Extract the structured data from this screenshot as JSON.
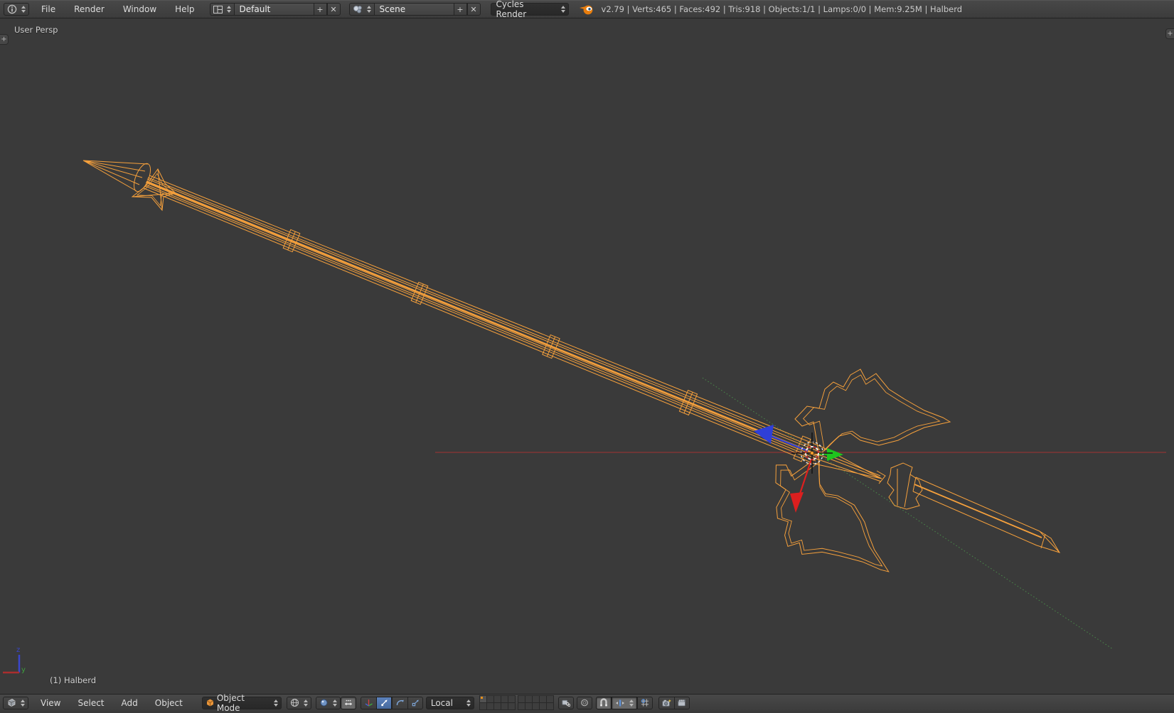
{
  "colors": {
    "wireframe": "#f5a03c",
    "grid_x_axis": "#8e3434",
    "grid_y_axis": "#4a8a4a",
    "manip_x": "#dc1f1f",
    "manip_y": "#1ec41e",
    "manip_z": "#2f3fd8",
    "accent_orange": "#e87d0d"
  },
  "icons": {
    "add_glyph": "+",
    "close_glyph": "✕"
  },
  "top_bar": {
    "menus": [
      "File",
      "Render",
      "Window",
      "Help"
    ],
    "layout_selector": {
      "value": "Default"
    },
    "scene_selector": {
      "value": "Scene"
    },
    "render_engine": "Cycles Render",
    "stats": "v2.79 | Verts:465 | Faces:492 | Tris:918 | Objects:1/1 | Lamps:0/0 | Mem:9.25M | Halberd"
  },
  "viewport": {
    "view_label": "User Persp",
    "object_info": "(1) Halberd",
    "gizmo": {
      "z": "z",
      "y": "y"
    }
  },
  "bottom_bar": {
    "menus": [
      "View",
      "Select",
      "Add",
      "Object"
    ],
    "mode": "Object Mode",
    "orientation": "Local"
  }
}
